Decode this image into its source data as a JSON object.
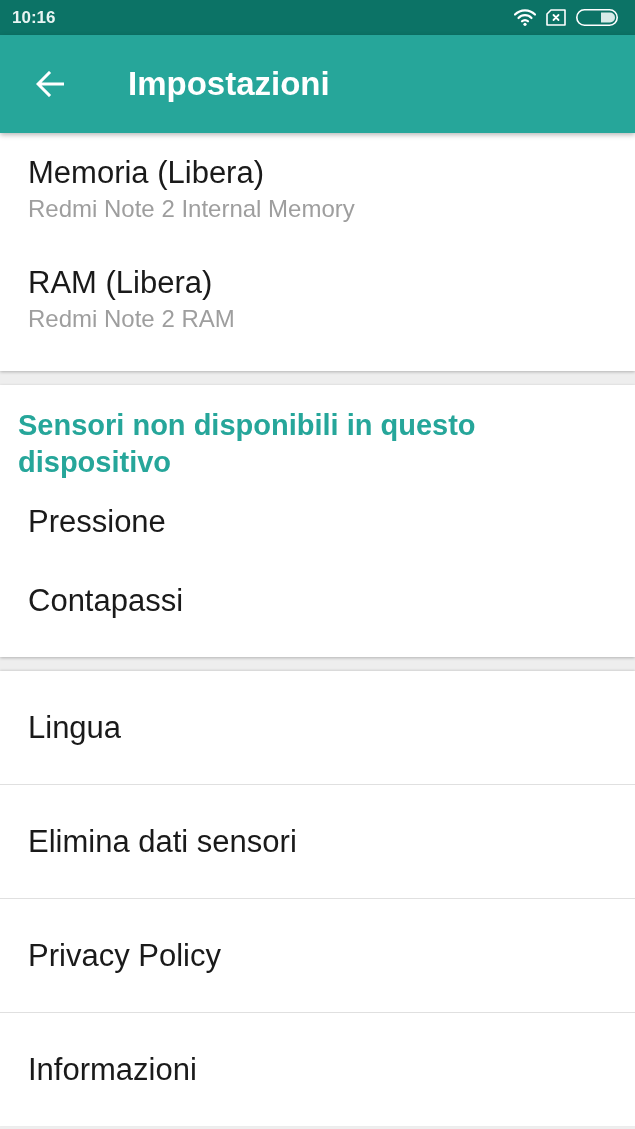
{
  "status_bar": {
    "time": "10:16"
  },
  "app_bar": {
    "title": "Impostazioni"
  },
  "sections": [
    {
      "divided": false,
      "items": [
        {
          "title": "Memoria (Libera)",
          "summary": "Redmi Note 2 Internal Memory"
        },
        {
          "title": "RAM (Libera)",
          "summary": "Redmi Note 2 RAM"
        }
      ]
    },
    {
      "header": "Sensori non disponibili in questo dispositivo",
      "divided": false,
      "items": [
        {
          "title": "Pressione"
        },
        {
          "title": "Contapassi"
        }
      ]
    },
    {
      "divided": true,
      "items": [
        {
          "title": "Lingua"
        },
        {
          "title": "Elimina dati sensori"
        },
        {
          "title": "Privacy Policy"
        },
        {
          "title": "Informazioni"
        }
      ]
    }
  ]
}
